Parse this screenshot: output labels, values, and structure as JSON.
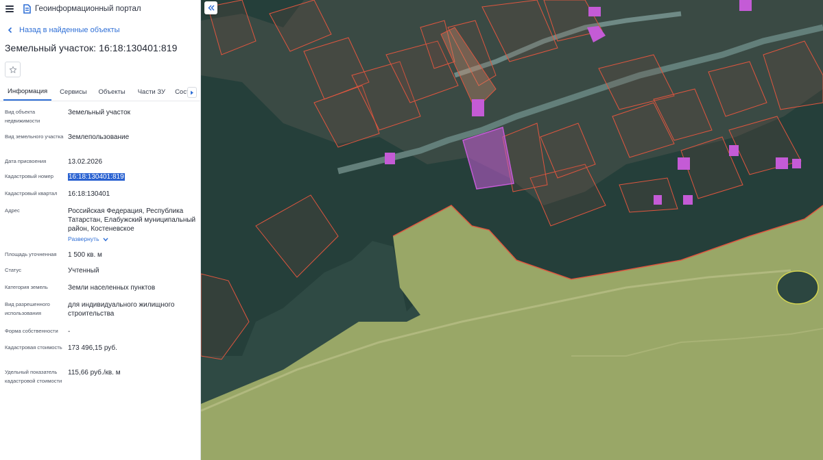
{
  "app": {
    "title": "Геоинформационный портал"
  },
  "nav": {
    "back_label": "Назад в найденные объекты"
  },
  "object": {
    "title": "Земельный участок: 16:18:130401:819"
  },
  "tabs": [
    {
      "label": "Информация"
    },
    {
      "label": "Сервисы"
    },
    {
      "label": "Объекты"
    },
    {
      "label": "Части ЗУ"
    },
    {
      "label": "Состав"
    }
  ],
  "properties": [
    {
      "label": "Вид объекта недвижимости",
      "value": "Земельный участок"
    },
    {
      "label": "Вид земельного участка",
      "value": "Землепользование"
    },
    {
      "label": "Дата присвоения",
      "value": "13.02.2026"
    },
    {
      "label": "Кадастровый номер",
      "value": "16:18:130401:819"
    },
    {
      "label": "Кадастровый квартал",
      "value": "16:18:130401"
    },
    {
      "label": "Адрес",
      "value": "Российская Федерация, Республика Татарстан, Елабужский муниципальный район, Костеневское",
      "expand_label": "Развернуть"
    },
    {
      "label": "Площадь уточненная",
      "value": "1 500 кв. м"
    },
    {
      "label": "Статус",
      "value": "Учтенный"
    },
    {
      "label": "Категория земель",
      "value": "Земли населенных пунктов"
    },
    {
      "label": "Вид разрешенного использования",
      "value": "для индивидуального жилищного строительства"
    },
    {
      "label": "Форма собственности",
      "value": "-"
    },
    {
      "label": "Кадастровая стоимость",
      "value": "173 496,15 руб."
    },
    {
      "label": "Удельный показатель кадастровой стоимости",
      "value": "115,66 руб./кв. м"
    }
  ],
  "icons": {
    "menu": "hamburger-icon",
    "logo": "portal-logo-icon",
    "back": "chevron-left-icon",
    "favorite": "star-icon",
    "tabs_scroll": "chevron-right-icon",
    "map_collapse": "double-chevron-left-icon",
    "expand": "chevron-down-icon"
  },
  "colors": {
    "accent": "#2f6fd6",
    "selection": "#2a62d1",
    "parcel_border": "#e0563f",
    "highlight_parcel": "#c45bd6",
    "field": "#9aa865"
  }
}
